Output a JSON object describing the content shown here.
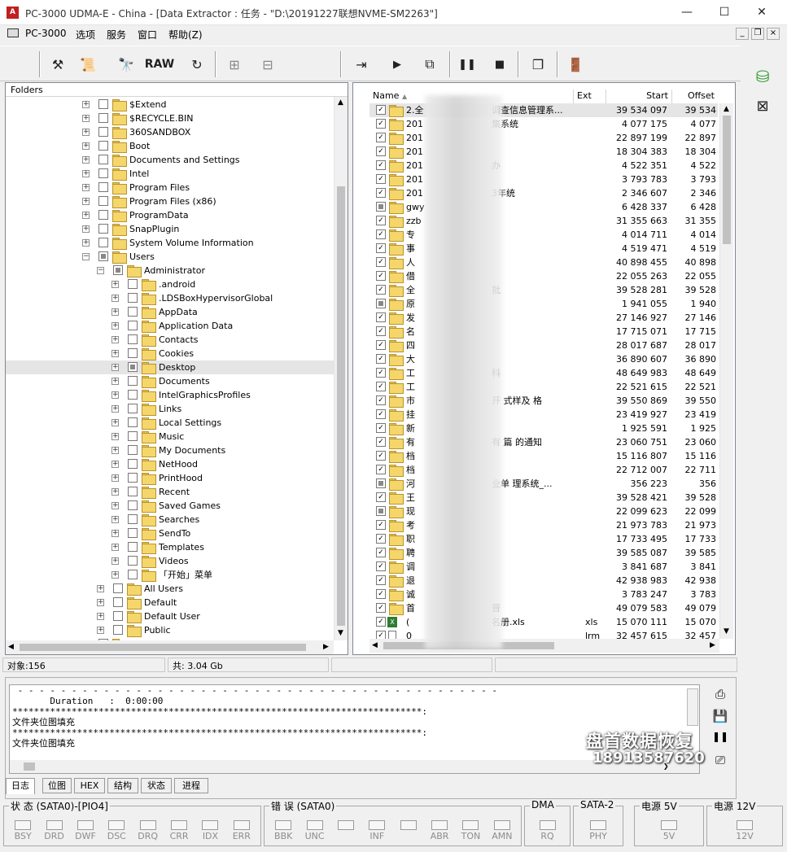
{
  "window": {
    "icon_text": "A",
    "title": "PC-3000 UDMA-E - China - [Data Extractor : 任务 - \"D:\\20191227联想NVME-SM2263\"]",
    "minimize": "—",
    "maximize": "☐",
    "close": "✕"
  },
  "menu": {
    "items": [
      "PC-3000",
      "选项",
      "服务",
      "窗口",
      "帮助(Z)"
    ],
    "mdi_controls": [
      "_",
      "❐",
      "×"
    ]
  },
  "toolbar": {
    "raw_label": "RAW"
  },
  "tree": {
    "header": "Folders",
    "rows": [
      {
        "label": "$Extend",
        "level": 1,
        "check": "none"
      },
      {
        "label": "$RECYCLE.BIN",
        "level": 1,
        "check": "none"
      },
      {
        "label": "360SANDBOX",
        "level": 1,
        "check": "none"
      },
      {
        "label": "Boot",
        "level": 1,
        "check": "none"
      },
      {
        "label": "Documents and Settings",
        "level": 1,
        "check": "none"
      },
      {
        "label": "Intel",
        "level": 1,
        "check": "none"
      },
      {
        "label": "Program Files",
        "level": 1,
        "check": "none"
      },
      {
        "label": "Program Files (x86)",
        "level": 1,
        "check": "none"
      },
      {
        "label": "ProgramData",
        "level": 1,
        "check": "none"
      },
      {
        "label": "SnapPlugin",
        "level": 1,
        "check": "none"
      },
      {
        "label": "System Volume Information",
        "level": 1,
        "check": "none"
      },
      {
        "label": "Users",
        "level": 1,
        "check": "part",
        "expanded": true
      },
      {
        "label": "Administrator",
        "level": 2,
        "check": "part",
        "expanded": true
      },
      {
        "label": ".android",
        "level": 3,
        "check": "none"
      },
      {
        "label": ".LDSBoxHypervisorGlobal",
        "level": 3,
        "check": "none"
      },
      {
        "label": "AppData",
        "level": 3,
        "check": "none"
      },
      {
        "label": "Application Data",
        "level": 3,
        "check": "none"
      },
      {
        "label": "Contacts",
        "level": 3,
        "check": "none"
      },
      {
        "label": "Cookies",
        "level": 3,
        "check": "none"
      },
      {
        "label": "Desktop",
        "level": 3,
        "check": "part",
        "selected": true
      },
      {
        "label": "Documents",
        "level": 3,
        "check": "none"
      },
      {
        "label": "IntelGraphicsProfiles",
        "level": 3,
        "check": "none"
      },
      {
        "label": "Links",
        "level": 3,
        "check": "none"
      },
      {
        "label": "Local Settings",
        "level": 3,
        "check": "none"
      },
      {
        "label": "Music",
        "level": 3,
        "check": "none"
      },
      {
        "label": "My Documents",
        "level": 3,
        "check": "none"
      },
      {
        "label": "NetHood",
        "level": 3,
        "check": "none"
      },
      {
        "label": "PrintHood",
        "level": 3,
        "check": "none"
      },
      {
        "label": "Recent",
        "level": 3,
        "check": "none"
      },
      {
        "label": "Saved Games",
        "level": 3,
        "check": "none"
      },
      {
        "label": "Searches",
        "level": 3,
        "check": "none"
      },
      {
        "label": "SendTo",
        "level": 3,
        "check": "none"
      },
      {
        "label": "Templates",
        "level": 3,
        "check": "none"
      },
      {
        "label": "Videos",
        "level": 3,
        "check": "none"
      },
      {
        "label": "「开始」菜单",
        "level": 3,
        "check": "none"
      },
      {
        "label": "All Users",
        "level": 2,
        "check": "none"
      },
      {
        "label": "Default",
        "level": 2,
        "check": "none"
      },
      {
        "label": "Default User",
        "level": 2,
        "check": "none"
      },
      {
        "label": "Public",
        "level": 2,
        "check": "none"
      },
      {
        "label": "Windows",
        "level": 1,
        "check": "none"
      }
    ]
  },
  "files": {
    "columns": [
      "Name",
      "Ext",
      "Start",
      "Offset"
    ],
    "rows": [
      {
        "name": "2.全",
        "tail": "调查信息管理系...",
        "ext": "",
        "start": "39 534 097",
        "offset": "39 534",
        "check": "full"
      },
      {
        "name": "201",
        "tail": "集系统",
        "ext": "",
        "start": "4 077 175",
        "offset": "4 077",
        "check": "full"
      },
      {
        "name": "201",
        "tail": "",
        "ext": "",
        "start": "22 897 199",
        "offset": "22 897",
        "check": "full"
      },
      {
        "name": "201",
        "tail": "",
        "ext": "",
        "start": "18 304 383",
        "offset": "18 304",
        "check": "full"
      },
      {
        "name": "201",
        "tail": "办",
        "ext": "",
        "start": "4 522 351",
        "offset": "4 522",
        "check": "full"
      },
      {
        "name": "201",
        "tail": "",
        "ext": "",
        "start": "3 793 783",
        "offset": "3 793",
        "check": "full"
      },
      {
        "name": "201",
        "tail": "3年统",
        "ext": "",
        "start": "2 346 607",
        "offset": "2 346",
        "check": "full"
      },
      {
        "name": "gwy",
        "tail": "",
        "ext": "",
        "start": "6 428 337",
        "offset": "6 428",
        "check": "part"
      },
      {
        "name": "zzb",
        "tail": "",
        "ext": "",
        "start": "31 355 663",
        "offset": "31 355",
        "check": "full"
      },
      {
        "name": "专",
        "tail": "",
        "ext": "",
        "start": "4 014 711",
        "offset": "4 014",
        "check": "full"
      },
      {
        "name": "事",
        "tail": "",
        "ext": "",
        "start": "4 519 471",
        "offset": "4 519",
        "check": "full"
      },
      {
        "name": "人",
        "tail": "",
        "ext": "",
        "start": "40 898 455",
        "offset": "40 898",
        "check": "full"
      },
      {
        "name": "借",
        "tail": "",
        "ext": "",
        "start": "22 055 263",
        "offset": "22 055",
        "check": "full"
      },
      {
        "name": "全",
        "tail": "批",
        "ext": "",
        "start": "39 528 281",
        "offset": "39 528",
        "check": "full"
      },
      {
        "name": "原",
        "tail": "",
        "ext": "",
        "start": "1 941 055",
        "offset": "1 940",
        "check": "part"
      },
      {
        "name": "发",
        "tail": "",
        "ext": "",
        "start": "27 146 927",
        "offset": "27 146",
        "check": "full"
      },
      {
        "name": "名",
        "tail": "",
        "ext": "",
        "start": "17 715 071",
        "offset": "17 715",
        "check": "full"
      },
      {
        "name": "四",
        "tail": "",
        "ext": "",
        "start": "28 017 687",
        "offset": "28 017",
        "check": "full"
      },
      {
        "name": "大",
        "tail": "",
        "ext": "",
        "start": "36 890 607",
        "offset": "36 890",
        "check": "full"
      },
      {
        "name": "工",
        "tail": "科",
        "ext": "",
        "start": "48 649 983",
        "offset": "48 649",
        "check": "full"
      },
      {
        "name": "工",
        "tail": "",
        "ext": "",
        "start": "22 521 615",
        "offset": "22 521",
        "check": "full"
      },
      {
        "name": "市",
        "tail": "开    式样及    格",
        "ext": "",
        "start": "39 550 869",
        "offset": "39 550",
        "check": "full"
      },
      {
        "name": "挂",
        "tail": "",
        "ext": "",
        "start": "23 419 927",
        "offset": "23 419",
        "check": "full"
      },
      {
        "name": "新",
        "tail": "",
        "ext": "",
        "start": "1 925 591",
        "offset": "1 925",
        "check": "full"
      },
      {
        "name": "有",
        "tail": "有    篇        的通知",
        "ext": "",
        "start": "23 060 751",
        "offset": "23 060",
        "check": "full"
      },
      {
        "name": "档",
        "tail": "",
        "ext": "",
        "start": "15 116 807",
        "offset": "15 116",
        "check": "full"
      },
      {
        "name": "档",
        "tail": "",
        "ext": "",
        "start": "22 712 007",
        "offset": "22 711",
        "check": "full"
      },
      {
        "name": "河",
        "tail": "业单         理系统_...",
        "ext": "",
        "start": "356 223",
        "offset": "356",
        "check": "part"
      },
      {
        "name": "王",
        "tail": "",
        "ext": "",
        "start": "39 528 421",
        "offset": "39 528",
        "check": "full"
      },
      {
        "name": "现",
        "tail": "",
        "ext": "",
        "start": "22 099 623",
        "offset": "22 099",
        "check": "part"
      },
      {
        "name": "考",
        "tail": "",
        "ext": "",
        "start": "21 973 783",
        "offset": "21 973",
        "check": "full"
      },
      {
        "name": "职",
        "tail": "",
        "ext": "",
        "start": "17 733 495",
        "offset": "17 733",
        "check": "full"
      },
      {
        "name": "聘",
        "tail": "",
        "ext": "",
        "start": "39 585 087",
        "offset": "39 585",
        "check": "full"
      },
      {
        "name": "调",
        "tail": "",
        "ext": "",
        "start": "3 841 687",
        "offset": "3 841",
        "check": "full"
      },
      {
        "name": "退",
        "tail": "",
        "ext": "",
        "start": "42 938 983",
        "offset": "42 938",
        "check": "full"
      },
      {
        "name": "诚",
        "tail": "",
        "ext": "",
        "start": "3 783 247",
        "offset": "3 783",
        "check": "full"
      },
      {
        "name": "首",
        "tail": "晋",
        "ext": "",
        "start": "49 079 583",
        "offset": "49 079",
        "check": "full"
      },
      {
        "name": "(",
        "tail": "名册.xls",
        "ext": "xls",
        "start": "15 070 111",
        "offset": "15 070",
        "check": "full",
        "file": "xls"
      },
      {
        "name": "0",
        "tail": "",
        "ext": "lrm",
        "start": "32 457 615",
        "offset": "32 457",
        "check": "full",
        "file": "doc"
      }
    ]
  },
  "status": {
    "objects": "对象:156",
    "total": "共:  3.04 Gb"
  },
  "log": {
    "lines": [
      " - - - - - - - - - - - - - - - - - - - - - - - - - - - - - - - - - - - - - - - - - - - - -",
      "       Duration   :  0:00:00",
      "****************************************************************************:",
      "文件夹位图填充",
      "****************************************************************************:",
      "文件夹位图填充"
    ]
  },
  "tabs": [
    "日志",
    "位图",
    "HEX",
    "结构",
    "状态",
    "进程"
  ],
  "watermark": {
    "line1": "盘首数据恢复",
    "line2": "18913587620"
  },
  "indicators": {
    "groups": [
      {
        "title": "状 态 (SATA0)-[PIO4]",
        "leds": [
          "BSY",
          "DRD",
          "DWF",
          "DSC",
          "DRQ",
          "CRR",
          "IDX",
          "ERR"
        ]
      },
      {
        "title": "错 误 (SATA0)",
        "leds": [
          "BBK",
          "UNC",
          "",
          "INF",
          "",
          "ABR",
          "TON",
          "AMN"
        ]
      },
      {
        "title": "DMA",
        "leds": [
          "RQ"
        ]
      },
      {
        "title": "SATA-2",
        "leds": [
          "PHY"
        ]
      },
      {
        "title": "电源 5V",
        "leds": [
          "5V"
        ]
      },
      {
        "title": "电源 12V",
        "leds": [
          "12V"
        ]
      }
    ]
  }
}
